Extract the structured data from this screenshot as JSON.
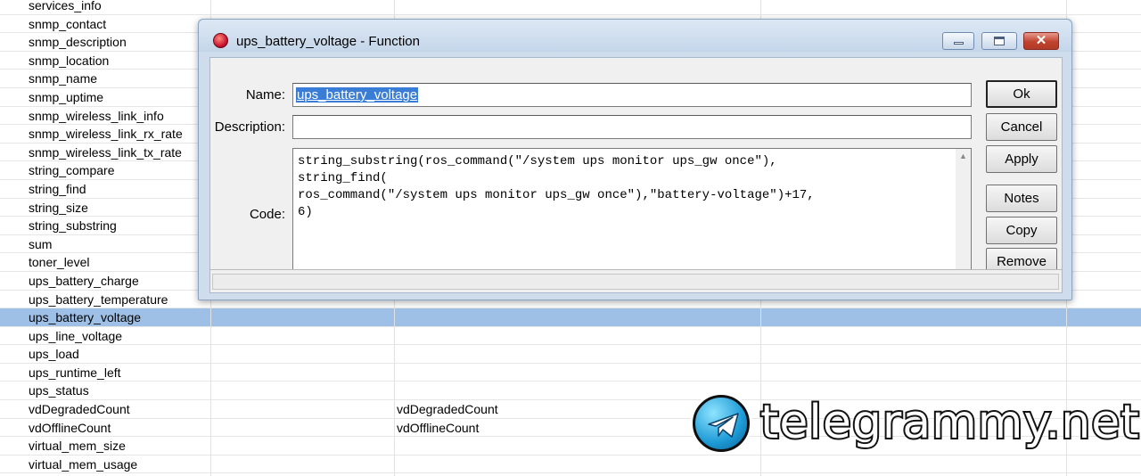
{
  "list": {
    "rows": [
      {
        "name": "services_info",
        "value": ""
      },
      {
        "name": "snmp_contact",
        "value": ""
      },
      {
        "name": "snmp_description",
        "value": ""
      },
      {
        "name": "snmp_location",
        "value": ""
      },
      {
        "name": "snmp_name",
        "value": ""
      },
      {
        "name": "snmp_uptime",
        "value": ""
      },
      {
        "name": "snmp_wireless_link_info",
        "value": ""
      },
      {
        "name": "snmp_wireless_link_rx_rate",
        "value": ""
      },
      {
        "name": "snmp_wireless_link_tx_rate",
        "value": ""
      },
      {
        "name": "string_compare",
        "value": ""
      },
      {
        "name": "string_find",
        "value": ""
      },
      {
        "name": "string_size",
        "value": ""
      },
      {
        "name": "string_substring",
        "value": ""
      },
      {
        "name": "sum",
        "value": ""
      },
      {
        "name": "toner_level",
        "value": ""
      },
      {
        "name": "ups_battery_charge",
        "value": ""
      },
      {
        "name": "ups_battery_temperature",
        "value": ""
      },
      {
        "name": "ups_battery_voltage",
        "value": ""
      },
      {
        "name": "ups_line_voltage",
        "value": ""
      },
      {
        "name": "ups_load",
        "value": ""
      },
      {
        "name": "ups_runtime_left",
        "value": ""
      },
      {
        "name": "ups_status",
        "value": ""
      },
      {
        "name": "vdDegradedCount",
        "value": "vdDegradedCount"
      },
      {
        "name": "vdOfflineCount",
        "value": "vdOfflineCount"
      },
      {
        "name": "virtual_mem_size",
        "value": ""
      },
      {
        "name": "virtual_mem_usage",
        "value": ""
      }
    ],
    "selected_index": 17,
    "selected_color": "#9fc0e6"
  },
  "dialog": {
    "title": "ups_battery_voltage - Function",
    "icon": "app-icon",
    "labels": {
      "name": "Name:",
      "description": "Description:",
      "code": "Code:"
    },
    "name_value": "ups_battery_voltage",
    "description_value": "",
    "code_value": "string_substring(ros_command(\"/system ups monitor ups_gw once\"),\nstring_find(\nros_command(\"/system ups monitor ups_gw once\"),\"battery-voltage\")+17,\n6)",
    "buttons": {
      "ok": "Ok",
      "cancel": "Cancel",
      "apply": "Apply",
      "notes": "Notes",
      "copy": "Copy",
      "remove": "Remove"
    },
    "status_text": ""
  },
  "watermark": {
    "text": "telegrammy.net",
    "icon": "telegram-plane-icon"
  }
}
